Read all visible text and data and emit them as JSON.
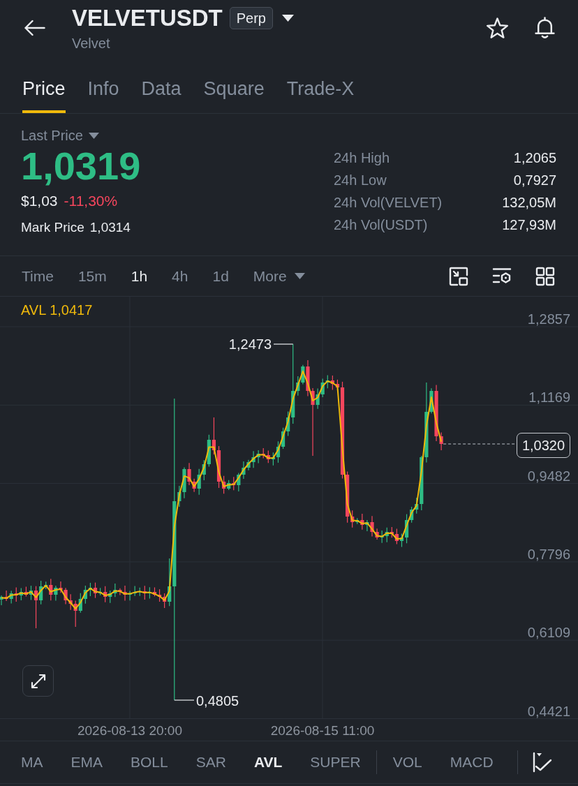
{
  "header": {
    "title": "VELVETUSDT",
    "badge": "Perp",
    "subtitle": "Velvet"
  },
  "tabs": [
    {
      "label": "Price",
      "selected": true
    },
    {
      "label": "Info",
      "selected": false
    },
    {
      "label": "Data",
      "selected": false
    },
    {
      "label": "Square",
      "selected": false
    },
    {
      "label": "Trade-X",
      "selected": false
    }
  ],
  "ticker": {
    "price_label": "Last Price",
    "last_price": "1,0319",
    "last_price_rising": true,
    "usd_price": "$1,03",
    "change": "-11,30%",
    "change_rising": false,
    "mark_price_label": "Mark Price",
    "mark_price": "1,0314",
    "stats": [
      {
        "label": "24h High",
        "value": "1,2065"
      },
      {
        "label": "24h Low",
        "value": "0,7927"
      },
      {
        "label": "24h Vol(VELVET)",
        "value": "132,05M"
      },
      {
        "label": "24h Vol(USDT)",
        "value": "127,93M"
      }
    ]
  },
  "intervals": [
    {
      "label": "Time",
      "kind": "option",
      "selected": false
    },
    {
      "label": "15m",
      "kind": "option",
      "selected": false
    },
    {
      "label": "1h",
      "kind": "option",
      "selected": true
    },
    {
      "label": "4h",
      "kind": "option",
      "selected": false
    },
    {
      "label": "1d",
      "kind": "option",
      "selected": false
    },
    {
      "label": "More",
      "kind": "dropdown",
      "selected": false
    }
  ],
  "chart": {
    "indicator_label": "AVL 1,0417",
    "y_labels": [
      "1,2857",
      "1,1169",
      "0,9482",
      "0,7796",
      "0,6109",
      "0,4421"
    ],
    "x_labels": [
      "2026-08-13 20:00",
      "2026-08-15 11:00"
    ],
    "high_label": "1,2473",
    "low_label": "0,4805",
    "last_price_tag": "1,0320"
  },
  "indicator_groups": [
    {
      "items": [
        {
          "label": "MA",
          "selected": false
        },
        {
          "label": "EMA",
          "selected": false
        },
        {
          "label": "BOLL",
          "selected": false
        },
        {
          "label": "SAR",
          "selected": false
        },
        {
          "label": "AVL",
          "selected": true
        },
        {
          "label": "SUPER",
          "selected": false
        }
      ]
    },
    {
      "items": [
        {
          "label": "VOL",
          "selected": false
        },
        {
          "label": "MACD",
          "selected": false
        }
      ]
    }
  ]
}
